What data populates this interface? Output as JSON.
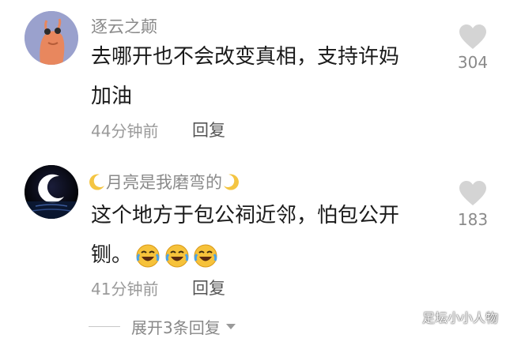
{
  "comments": [
    {
      "username": "逐云之颠",
      "text_line1": "去哪开也不会改变真相，支持许妈",
      "text_line2": "加油",
      "time": "44分钟前",
      "reply_label": "回复",
      "like_count": "304",
      "avatar_icon": "shrimp-avatar",
      "like_icon": "heart-icon"
    },
    {
      "username": "月亮是我磨弯的",
      "text_line1": "这个地方于包公祠近邻，怕包公开",
      "text_line2": "铡。",
      "time": "41分钟前",
      "reply_label": "回复",
      "like_count": "183",
      "avatar_icon": "moon-avatar",
      "like_icon": "heart-icon"
    }
  ],
  "expand_replies": "展开3条回复",
  "watermark": "足坛小小人物",
  "colors": {
    "text": "#1a1a1a",
    "muted": "#8a8a8a",
    "heart": "#d4d4d4",
    "background": "#ffffff"
  }
}
